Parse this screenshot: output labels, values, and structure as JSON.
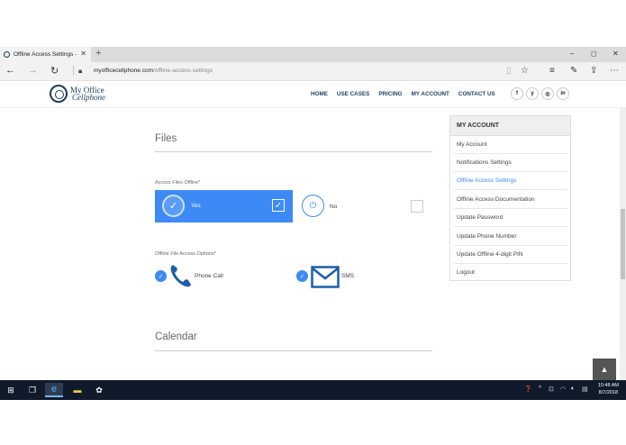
{
  "browser": {
    "tab_title": "Offline Access Settings -",
    "tab_close": "✕",
    "new_tab": "+",
    "url_domain": "myofficecellphone.com",
    "url_path": "/offline-access-settings",
    "window_controls": [
      "–",
      "◻",
      "✕"
    ]
  },
  "site": {
    "logo_line1": "My Office",
    "logo_line2": "Cellphone",
    "nav": [
      "HOME",
      "USE CASES",
      "PRICING",
      "MY ACCOUNT",
      "CONTACT US"
    ],
    "social": [
      "f",
      "y",
      "◎",
      "in"
    ]
  },
  "files": {
    "title": "Files",
    "access_label": "Access Files Offline*",
    "yes_label": "Yes",
    "no_label": "No",
    "options_label": "Offline File Access Options*",
    "phone_label": "Phone Call",
    "sms_label": "SMS"
  },
  "calendar": {
    "title": "Calendar"
  },
  "account_menu": {
    "heading": "MY ACCOUNT",
    "items": [
      "My Account",
      "Notifications Settings",
      "Offline Access Settings",
      "Offline Access Documentation",
      "Update Password",
      "Update Phone Number",
      "Update Offline 4-digit PIN",
      "Logout"
    ],
    "active_item": "Offline Access Settings"
  },
  "taskbar": {
    "time": "10:48 AM",
    "date": "8/7/2018"
  },
  "colors": {
    "accent": "#3d8af7",
    "brand": "#1c3d5a",
    "taskbar": "#0f1a2a"
  }
}
